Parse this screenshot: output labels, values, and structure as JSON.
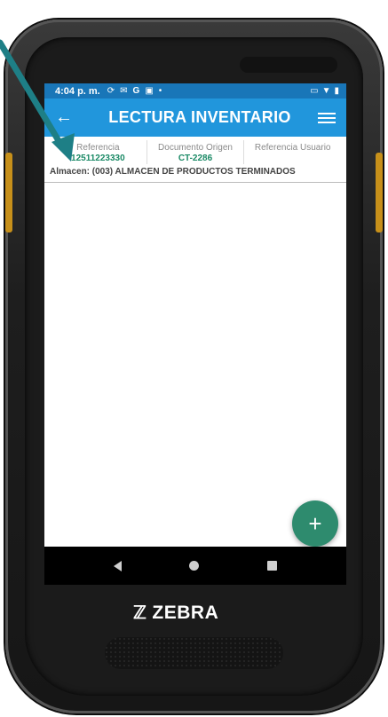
{
  "statusbar": {
    "time": "4:04 p. m.",
    "icons": [
      "sync-icon",
      "mail-icon",
      "google-icon",
      "image-icon",
      "dot-icon"
    ],
    "right_icons": [
      "cast-icon",
      "wifi-icon",
      "battery-icon"
    ]
  },
  "appbar": {
    "title": "LECTURA INVENTARIO"
  },
  "record": {
    "columns": [
      {
        "label": "Referencia",
        "value": "12511223330"
      },
      {
        "label": "Documento Origen",
        "value": "CT-2286"
      },
      {
        "label": "Referencia Usuario",
        "value": ""
      }
    ],
    "almacen": "Almacen: (003) ALMACEN DE PRODUCTOS TERMINADOS"
  },
  "fab": {
    "label": "+"
  },
  "brand": {
    "name": "ZEBRA"
  },
  "colors": {
    "statusbar": "#1976b8",
    "appbar": "#2196dc",
    "accent_value": "#1b8a66",
    "fab": "#2e8b6e",
    "annotation_arrow": "#1e7f86"
  }
}
